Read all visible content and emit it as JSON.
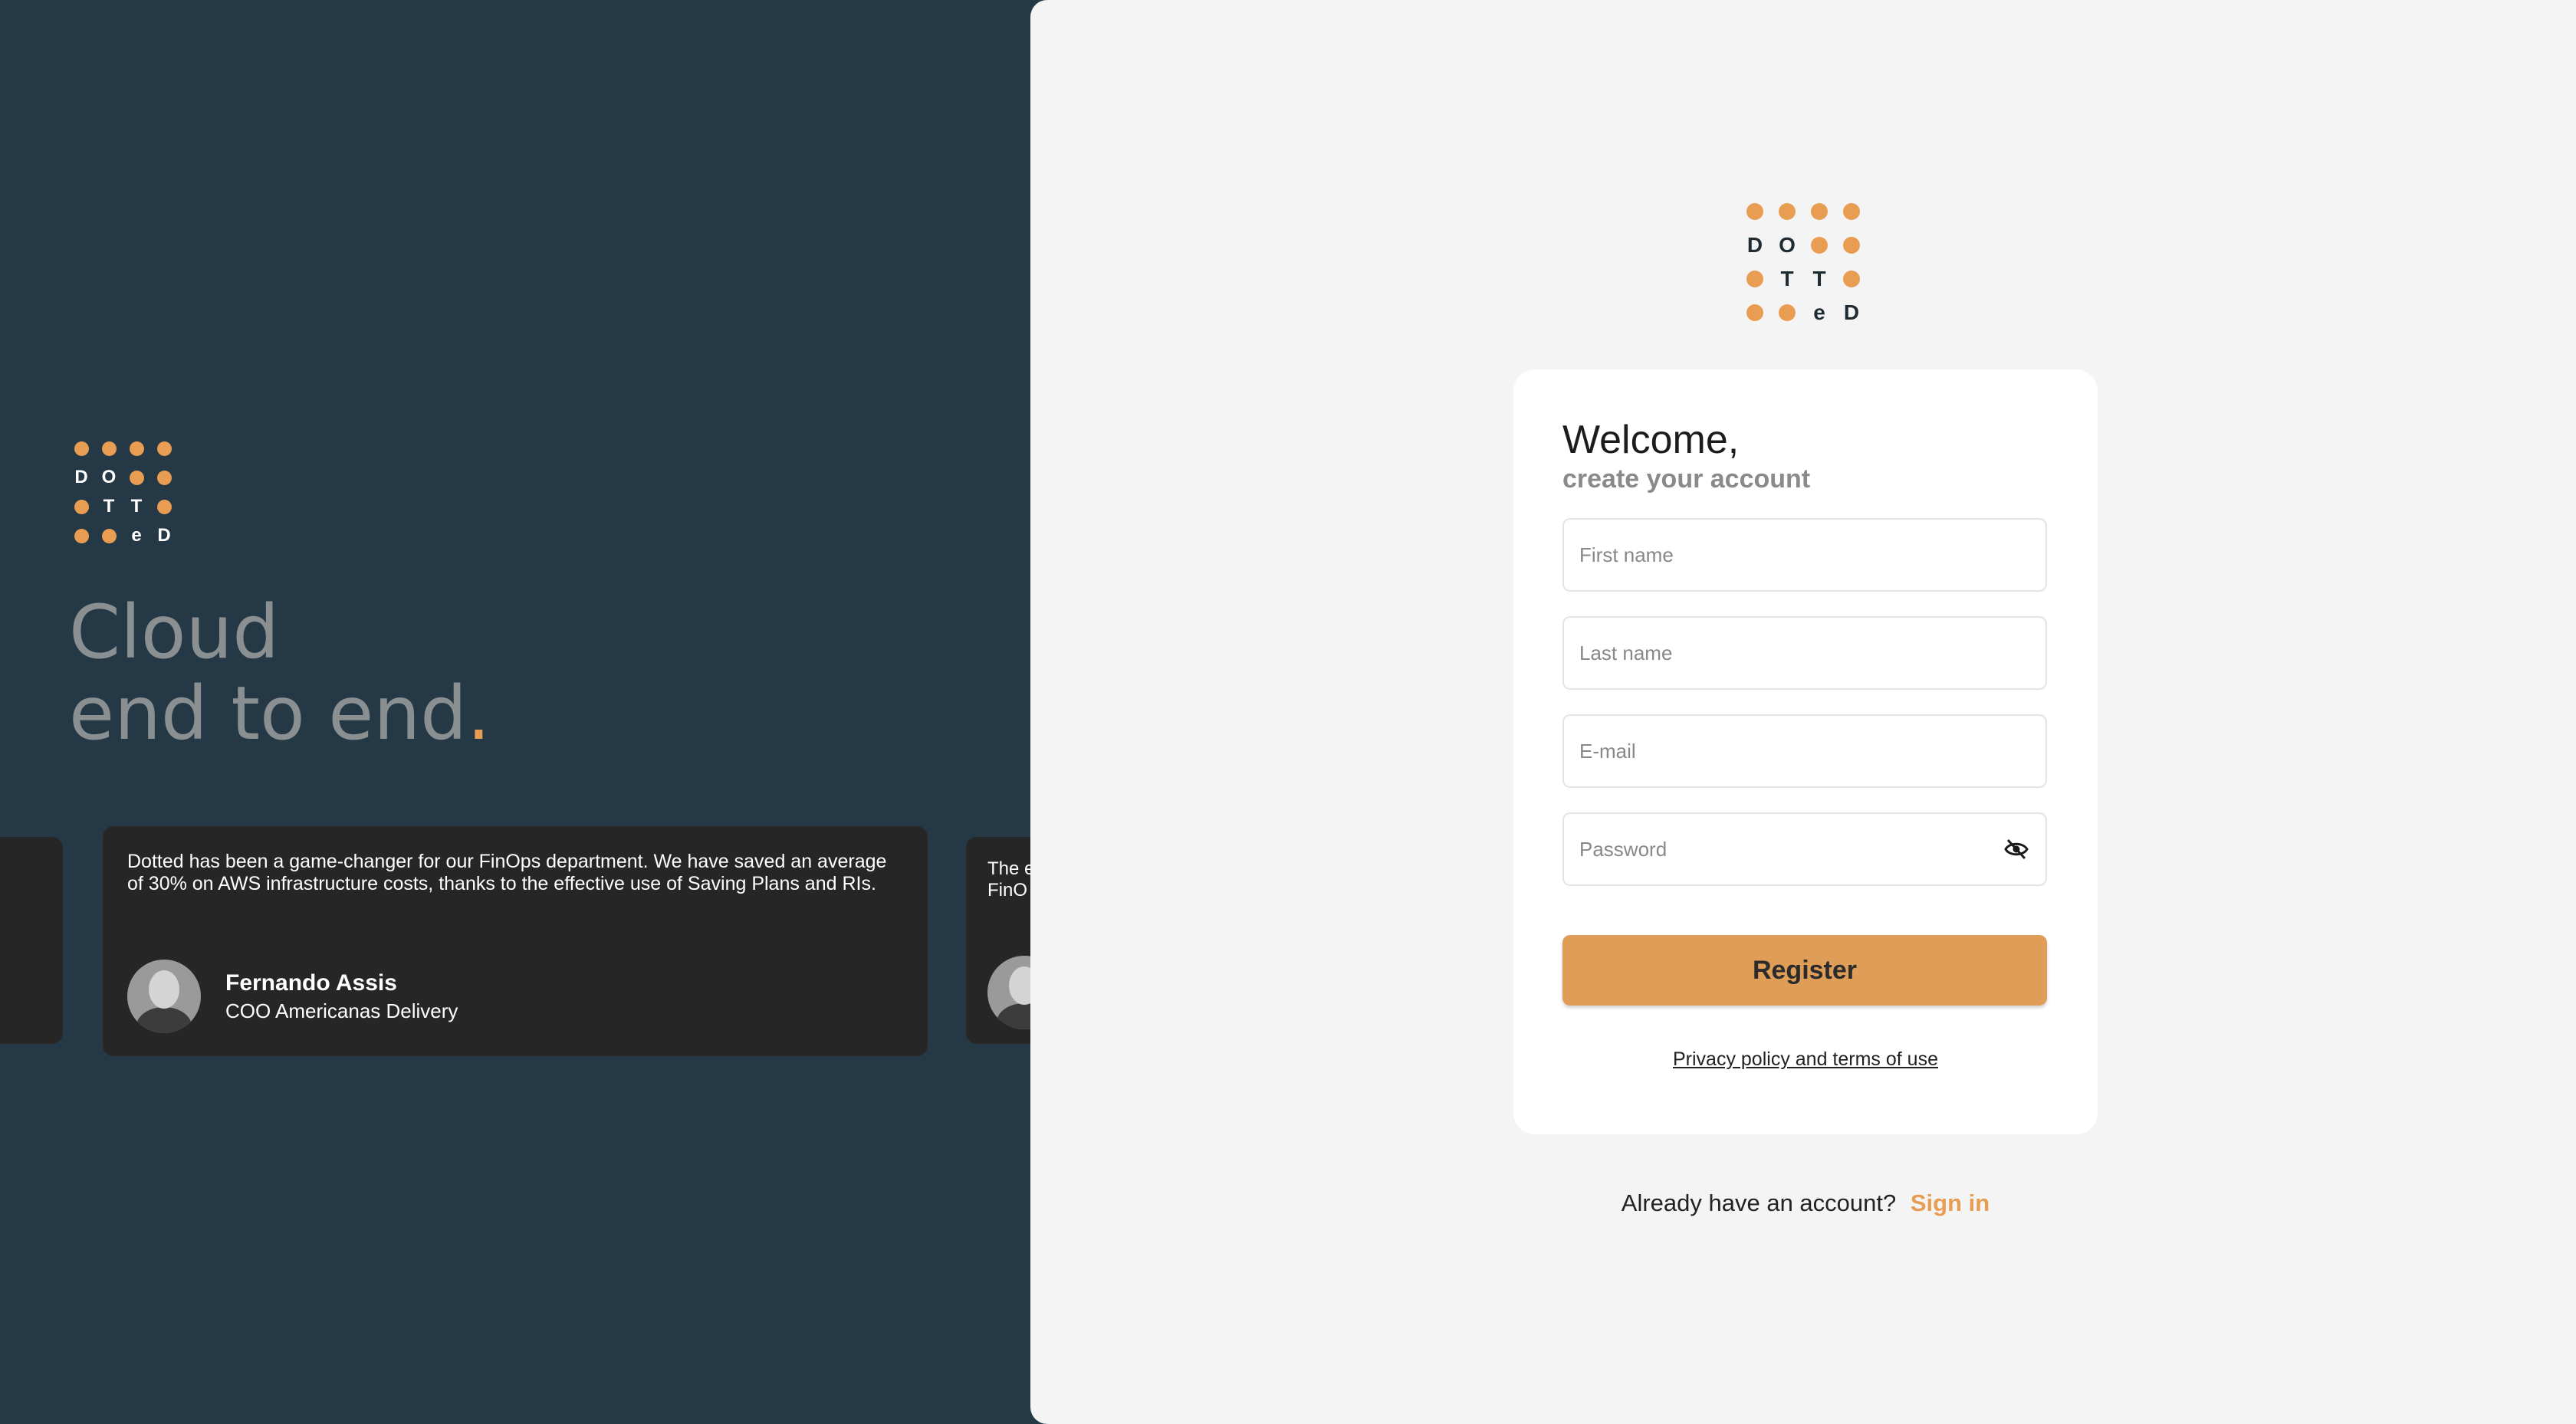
{
  "brand": {
    "logo_rows": [
      [
        "dot",
        "dot",
        "dot",
        "dot"
      ],
      [
        "D",
        "O",
        "dot",
        "dot"
      ],
      [
        "dot",
        "T",
        "T",
        "dot"
      ],
      [
        "dot",
        "dot",
        "e",
        "D"
      ]
    ],
    "accent_color": "#e89d52",
    "dark_color": "#253845"
  },
  "hero": {
    "line1": "Cloud",
    "line2": "end to end",
    "period": "."
  },
  "testimonials": {
    "main": {
      "quote": "Dotted has been a game-changer for our FinOps department. We have saved an average of 30% on AWS infrastructure costs, thanks to the effective use of Saving Plans and RIs.",
      "name": "Fernando Assis",
      "role": "COO Americanas Delivery"
    },
    "next": {
      "quote_line1": "The e",
      "quote_line2": "FinO"
    }
  },
  "form": {
    "welcome": "Welcome,",
    "subtitle": "create your account",
    "first_name_placeholder": "First name",
    "last_name_placeholder": "Last name",
    "email_placeholder": "E-mail",
    "password_placeholder": "Password",
    "password_toggle_icon": "eye-off-icon",
    "register_label": "Register",
    "policy_link": "Privacy policy and terms of use"
  },
  "footer": {
    "question": "Already have an account?",
    "signin_label": "Sign in"
  }
}
